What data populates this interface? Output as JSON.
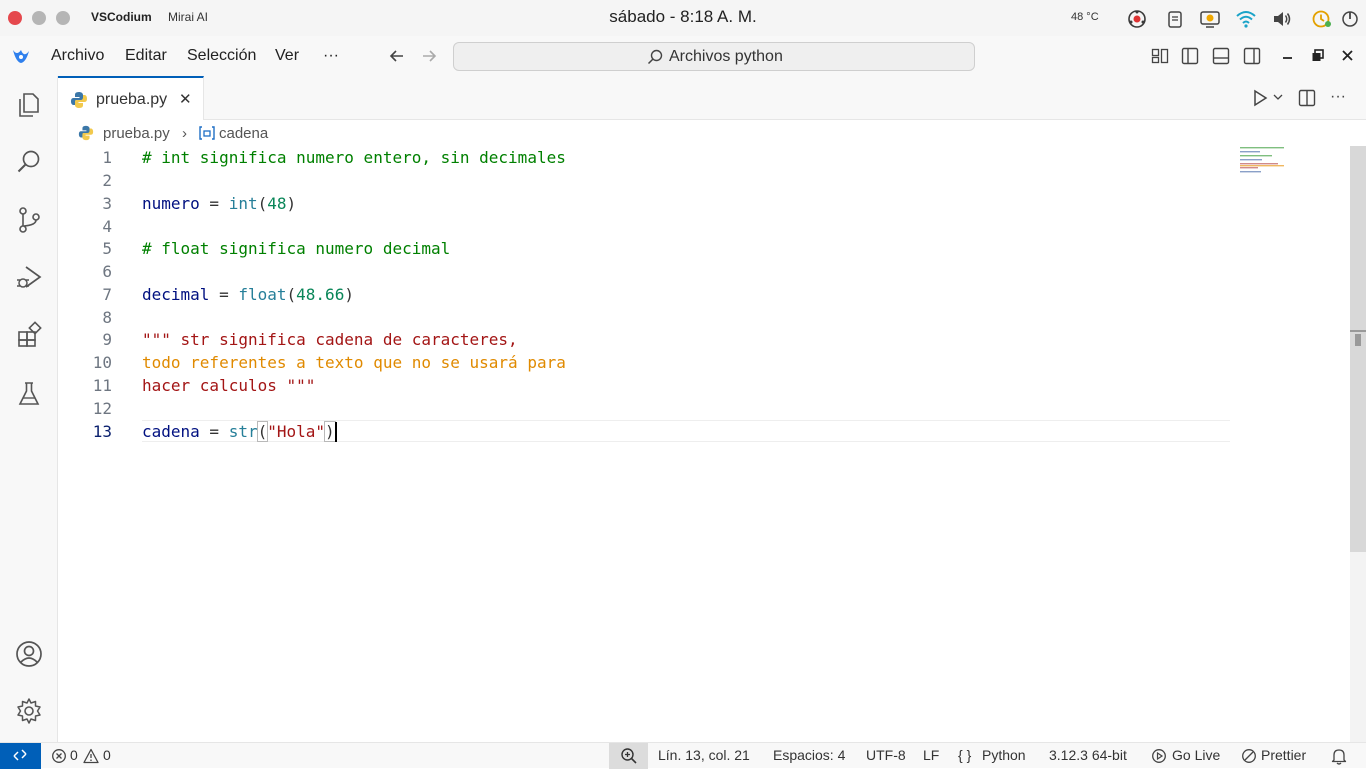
{
  "os_bar": {
    "app_name": "VSCodium",
    "window_name": "Mirai AI",
    "clock": "sábado - 8:18 A. M.",
    "temperature": "48 °C"
  },
  "menu": {
    "items": [
      "Archivo",
      "Editar",
      "Selección",
      "Ver",
      "···"
    ],
    "command_center": "Archivos python"
  },
  "tab": {
    "label": "prueba.py",
    "close_glyph": "✕"
  },
  "breadcrumb": {
    "file": "prueba.py",
    "separator": "›",
    "symbol": "cadena"
  },
  "editor": {
    "line_numbers": [
      "1",
      "2",
      "3",
      "4",
      "5",
      "6",
      "7",
      "8",
      "9",
      "10",
      "11",
      "12",
      "13"
    ],
    "line1": "# int significa numero entero, sin decimales",
    "line3": {
      "var": "numero",
      "op": " = ",
      "fn": "int",
      "open": "(",
      "num": "48",
      "close": ")"
    },
    "line5": "# float significa numero decimal",
    "line7": {
      "var": "decimal",
      "op": " = ",
      "fn": "float",
      "open": "(",
      "num": "48.66",
      "close": ")"
    },
    "line9": "\"\"\" str significa cadena de caracteres,",
    "line10": "todo referentes a texto que no se usará para",
    "line11": "hacer calculos \"\"\"",
    "line13": {
      "var": "cadena",
      "op": " = ",
      "fn": "str",
      "open": "(",
      "str": "\"Hola\"",
      "close": ")"
    }
  },
  "status": {
    "errors": "0",
    "warnings": "0",
    "position": "Lín. 13, col. 21",
    "spaces": "Espacios: 4",
    "encoding": "UTF-8",
    "eol": "LF",
    "language_glyph": "{ }",
    "language": "Python",
    "interpreter": "3.12.3 64-bit",
    "go_live": "Go Live",
    "prettier": "Prettier"
  },
  "colors": {
    "accent": "#005fb8",
    "comment": "#008000",
    "string": "#a31515",
    "number": "#098658",
    "function": "#267f99"
  }
}
